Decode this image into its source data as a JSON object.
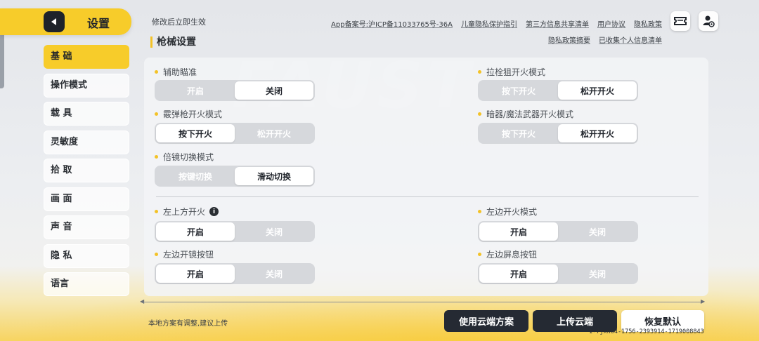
{
  "header": {
    "title": "设置",
    "notice": "修改后立即生效",
    "section_title": "枪械设置",
    "links_row1": [
      "App备案号:沪ICP备11033765号-36A",
      "儿童隐私保护指引",
      "第三方信息共享清单",
      "用户协议",
      "隐私政策"
    ],
    "links_row2": [
      "隐私政策摘要",
      "已收集个人信息清单"
    ],
    "icons": [
      "ticket-icon",
      "user-settings-icon"
    ]
  },
  "sidebar": {
    "items": [
      {
        "label": "基 础",
        "active": true
      },
      {
        "label": "操作模式",
        "active": false
      },
      {
        "label": "载 具",
        "active": false
      },
      {
        "label": "灵敏度",
        "active": false
      },
      {
        "label": "拾 取",
        "active": false
      },
      {
        "label": "画 面",
        "active": false
      },
      {
        "label": "声 音",
        "active": false
      },
      {
        "label": "隐 私",
        "active": false
      },
      {
        "label": "语言",
        "active": false
      }
    ]
  },
  "settings": {
    "aim_assist": {
      "label": "辅助瞄准",
      "options": [
        "开启",
        "关闭"
      ],
      "selected": 1
    },
    "bolt_sniper": {
      "label": "拉栓狙开火模式",
      "options": [
        "按下开火",
        "松开开火"
      ],
      "selected": 1
    },
    "shotgun": {
      "label": "霰弹枪开火模式",
      "options": [
        "按下开火",
        "松开开火"
      ],
      "selected": 0
    },
    "hidden_magic": {
      "label": "暗器/魔法武器开火模式",
      "options": [
        "按下开火",
        "松开开火"
      ],
      "selected": 1
    },
    "scope_switch": {
      "label": "倍镜切换模式",
      "options": [
        "按键切换",
        "滑动切换"
      ],
      "selected": 1
    },
    "top_left_fire": {
      "label": "左上方开火",
      "options": [
        "开启",
        "关闭"
      ],
      "selected": 0
    },
    "left_fire_mode": {
      "label": "左边开火模式",
      "options": [
        "开启",
        "关闭"
      ],
      "selected": 0
    },
    "left_scope_btn": {
      "label": "左边开镜按钮",
      "options": [
        "开启",
        "关闭"
      ],
      "selected": 0
    },
    "left_breath_btn": {
      "label": "左边屏息按钮",
      "options": [
        "开启",
        "关闭"
      ],
      "selected": 0
    }
  },
  "footer": {
    "note": "本地方案有调整,建议上传",
    "use_cloud": "使用云端方案",
    "upload_cloud": "上传云端",
    "restore_default": "恢复默认",
    "build_id": "1-7jxno4-1756-2393914-1719008843"
  }
}
